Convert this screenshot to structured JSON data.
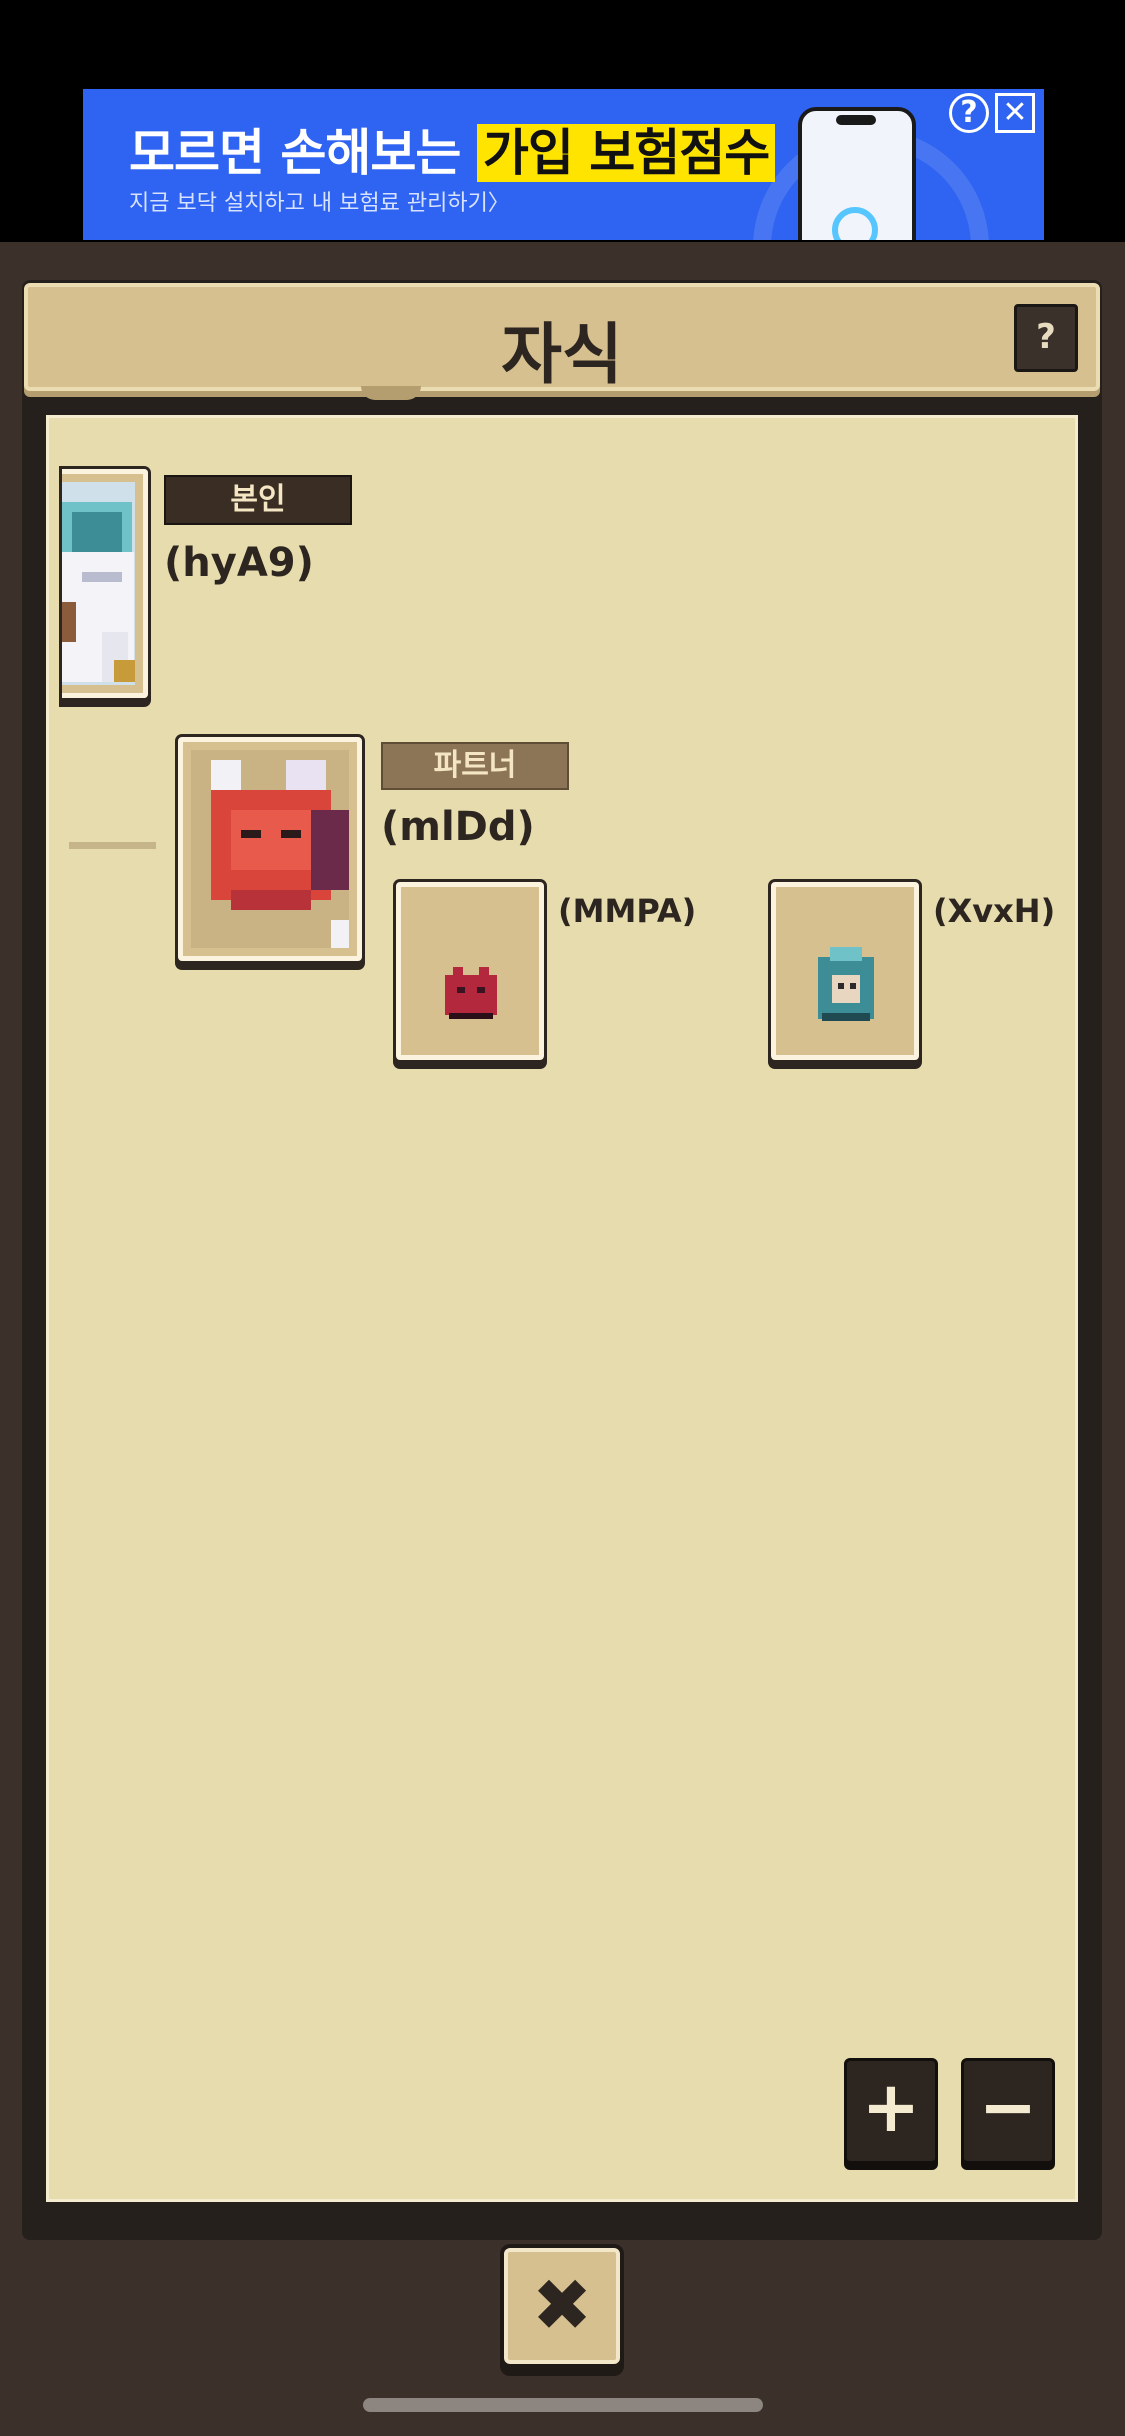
{
  "ad": {
    "title_prefix": "모르면 손해보는 ",
    "title_highlight": "가입 보험점수",
    "subtitle": "지금 보닥 설치하고 내 보험료 관리하기〉",
    "info_symbol": "?",
    "close_symbol": "✕"
  },
  "header": {
    "title": "자식",
    "help_label": "?"
  },
  "tree": {
    "self": {
      "tag": "본인",
      "name": "(hyA9)"
    },
    "partner": {
      "tag": "파트너",
      "name": "(mlDd)"
    },
    "children": [
      {
        "name": "(MMPA)"
      },
      {
        "name": "(XvxH)"
      }
    ]
  },
  "controls": {
    "zoom_in": "+",
    "zoom_out": "−",
    "close": "✖"
  },
  "colors": {
    "parchment": "#e7dcae",
    "header": "#d6c08f",
    "dark_frame": "#25201c",
    "ad_blue": "#2f63f1",
    "ad_highlight": "#ffe400"
  }
}
